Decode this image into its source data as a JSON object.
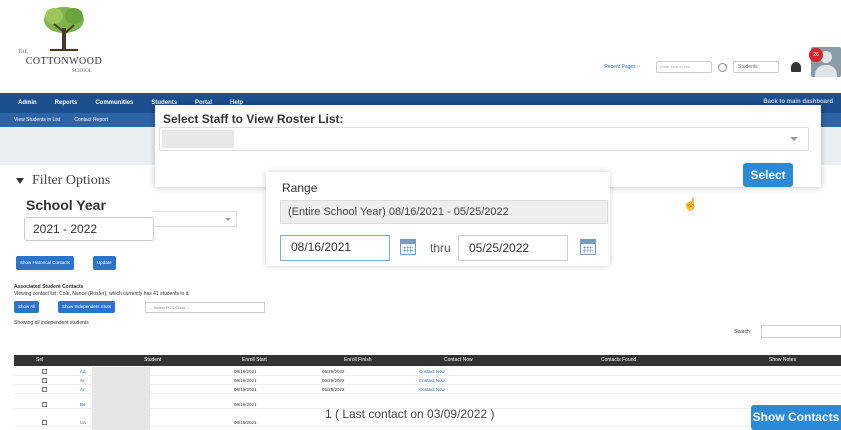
{
  "logo": {
    "the": "THE",
    "name": "COTTONWOOD",
    "school": "SCHOOL"
  },
  "header": {
    "recent_pages": "Recent Pages ~",
    "search_placeholder": "Enter search text",
    "students_select": "Students",
    "notification_count": "26"
  },
  "nav": {
    "items": [
      "Admin",
      "Reports",
      "Communities",
      "Students",
      "Portal",
      "Help"
    ],
    "right": "Back to main dashboard"
  },
  "subnav": {
    "items": [
      "View Students in List",
      "Contact Report"
    ]
  },
  "filter": {
    "heading": "Filter Options",
    "school_year_label": "School Year",
    "school_year_value": "2021 - 2022",
    "btn_historical": "Show Historical Contacts",
    "btn_update": "Update"
  },
  "assoc": {
    "title": "Associated Student Contacts",
    "desc": "Viewing contact list: Cole, Nance (Roster), which currently has 41 students in it.",
    "btn_show_all": "Show All",
    "btn_show_independent": "Show Independent Stuts",
    "pcs_placeholder": "-- Select PCS Class --",
    "showing": "Showing all independent students",
    "search_label": "Search:"
  },
  "table": {
    "headers": [
      "Sel",
      "Student",
      "Enroll Start",
      "Enroll Finish",
      "Contact Now",
      "Contacts Found",
      "Show Notes"
    ],
    "rows": [
      {
        "student": "Ad",
        "start": "08/16/2021",
        "finish": "05/25/2022",
        "contact": "Contact Now"
      },
      {
        "student": "Ar",
        "start": "08/16/2021",
        "finish": "05/25/2022",
        "contact": "Contact Now"
      },
      {
        "student": "Ar",
        "start": "08/16/2021",
        "finish": "05/25/2022",
        "contact": "Contact Now"
      },
      {
        "student": "Be",
        "start": "08/16/2021",
        "finish": "",
        "contact": ""
      },
      {
        "student": "Ca",
        "start": "08/16/2021",
        "finish": "",
        "contact": ""
      }
    ]
  },
  "modal": {
    "title": "Select Staff to View Roster List:",
    "select_button": "Select"
  },
  "range": {
    "label": "Range",
    "selected": "(Entire School Year) 08/16/2021 - 05/25/2022",
    "from": "08/16/2021",
    "thru": "thru",
    "to": "05/25/2022"
  },
  "footer": {
    "last_contact": "1 ( Last contact on 03/09/2022 )",
    "show_contacts": "Show Contacts"
  }
}
